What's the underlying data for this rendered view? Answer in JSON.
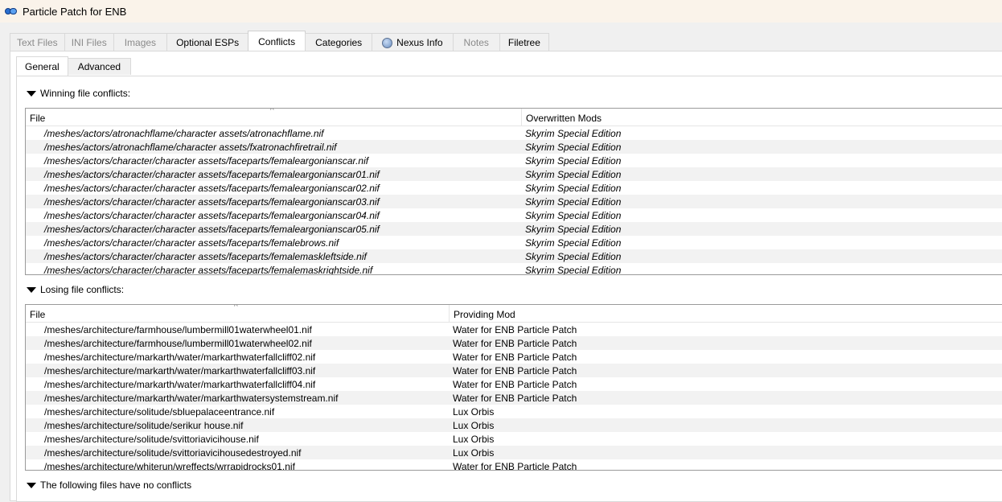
{
  "window": {
    "title": "Particle Patch for ENB"
  },
  "tabs": [
    {
      "label": "Text Files",
      "state": "disabled"
    },
    {
      "label": "INI Files",
      "state": "disabled"
    },
    {
      "label": "Images",
      "state": "disabled"
    },
    {
      "label": "Optional ESPs",
      "state": "normal"
    },
    {
      "label": "Conflicts",
      "state": "active"
    },
    {
      "label": "Categories",
      "state": "normal"
    },
    {
      "label": "Nexus Info",
      "state": "normal",
      "icon": "globe-icon"
    },
    {
      "label": "Notes",
      "state": "disabled"
    },
    {
      "label": "Filetree",
      "state": "normal"
    }
  ],
  "subtabs": [
    {
      "label": "General",
      "state": "active"
    },
    {
      "label": "Advanced",
      "state": "normal"
    }
  ],
  "winning": {
    "header": "Winning file conflicts:",
    "col_file": "File",
    "col_other": "Overwritten Mods",
    "sort_glyph": "^",
    "rows": [
      {
        "file": "/meshes/actors/atronachflame/character assets/atronachflame.nif",
        "mod": "Skyrim Special Edition"
      },
      {
        "file": "/meshes/actors/atronachflame/character assets/fxatronachfiretrail.nif",
        "mod": "Skyrim Special Edition"
      },
      {
        "file": "/meshes/actors/character/character assets/faceparts/femaleargonianscar.nif",
        "mod": "Skyrim Special Edition"
      },
      {
        "file": "/meshes/actors/character/character assets/faceparts/femaleargonianscar01.nif",
        "mod": "Skyrim Special Edition"
      },
      {
        "file": "/meshes/actors/character/character assets/faceparts/femaleargonianscar02.nif",
        "mod": "Skyrim Special Edition"
      },
      {
        "file": "/meshes/actors/character/character assets/faceparts/femaleargonianscar03.nif",
        "mod": "Skyrim Special Edition"
      },
      {
        "file": "/meshes/actors/character/character assets/faceparts/femaleargonianscar04.nif",
        "mod": "Skyrim Special Edition"
      },
      {
        "file": "/meshes/actors/character/character assets/faceparts/femaleargonianscar05.nif",
        "mod": "Skyrim Special Edition"
      },
      {
        "file": "/meshes/actors/character/character assets/faceparts/femalebrows.nif",
        "mod": "Skyrim Special Edition"
      },
      {
        "file": "/meshes/actors/character/character assets/faceparts/femalemaskleftside.nif",
        "mod": "Skyrim Special Edition"
      },
      {
        "file": "/meshes/actors/character/character assets/faceparts/femalemaskrightside.nif",
        "mod": "Skyrim Special Edition"
      }
    ]
  },
  "losing": {
    "header": "Losing file conflicts:",
    "col_file": "File",
    "col_other": "Providing Mod",
    "sort_glyph": "^",
    "rows": [
      {
        "file": "/meshes/architecture/farmhouse/lumbermill01waterwheel01.nif",
        "mod": "Water for ENB Particle Patch"
      },
      {
        "file": "/meshes/architecture/farmhouse/lumbermill01waterwheel02.nif",
        "mod": "Water for ENB Particle Patch"
      },
      {
        "file": "/meshes/architecture/markarth/water/markarthwaterfallcliff02.nif",
        "mod": "Water for ENB Particle Patch"
      },
      {
        "file": "/meshes/architecture/markarth/water/markarthwaterfallcliff03.nif",
        "mod": "Water for ENB Particle Patch"
      },
      {
        "file": "/meshes/architecture/markarth/water/markarthwaterfallcliff04.nif",
        "mod": "Water for ENB Particle Patch"
      },
      {
        "file": "/meshes/architecture/markarth/water/markarthwatersystemstream.nif",
        "mod": "Water for ENB Particle Patch"
      },
      {
        "file": "/meshes/architecture/solitude/sbluepalaceentrance.nif",
        "mod": "Lux Orbis"
      },
      {
        "file": "/meshes/architecture/solitude/serikur house.nif",
        "mod": "Lux Orbis"
      },
      {
        "file": "/meshes/architecture/solitude/svittoriavicihouse.nif",
        "mod": "Lux Orbis"
      },
      {
        "file": "/meshes/architecture/solitude/svittoriavicihousedestroyed.nif",
        "mod": "Lux Orbis"
      },
      {
        "file": "/meshes/architecture/whiterun/wreffects/wrrapidrocks01.nif",
        "mod": "Water for ENB Particle Patch"
      }
    ]
  },
  "noconflict": {
    "header": "The following files have no conflicts"
  }
}
